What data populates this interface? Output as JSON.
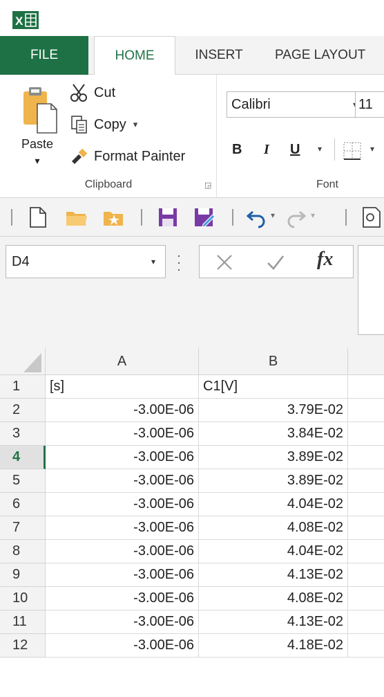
{
  "ribbon": {
    "tabs": {
      "file": "FILE",
      "home": "HOME",
      "insert": "INSERT",
      "page_layout": "PAGE LAYOUT"
    },
    "clipboard": {
      "paste": "Paste",
      "cut": "Cut",
      "copy": "Copy",
      "format_painter": "Format Painter",
      "group_label": "Clipboard"
    },
    "font": {
      "name": "Calibri",
      "size": "11",
      "bold": "B",
      "italic": "I",
      "underline": "U",
      "group_label": "Font"
    }
  },
  "icons": {
    "app": "excel-icon",
    "cut": "scissors-icon",
    "copy": "copy-icon",
    "format_painter": "paintbrush-icon",
    "qat": [
      "new-document-icon",
      "open-folder-icon",
      "favorite-folder-icon",
      "save-icon",
      "save-as-icon",
      "undo-icon",
      "redo-icon",
      "print-preview-icon"
    ]
  },
  "formula_bar": {
    "name_box": "D4",
    "fx": "fx",
    "formula": ""
  },
  "grid": {
    "columns": [
      "A",
      "B"
    ],
    "active_row": 4,
    "rows": [
      {
        "n": "1",
        "a": "[s]",
        "b": "C1[V]"
      },
      {
        "n": "2",
        "a": "-3.00E-06",
        "b": "3.79E-02"
      },
      {
        "n": "3",
        "a": "-3.00E-06",
        "b": "3.84E-02"
      },
      {
        "n": "4",
        "a": "-3.00E-06",
        "b": "3.89E-02"
      },
      {
        "n": "5",
        "a": "-3.00E-06",
        "b": "3.89E-02"
      },
      {
        "n": "6",
        "a": "-3.00E-06",
        "b": "4.04E-02"
      },
      {
        "n": "7",
        "a": "-3.00E-06",
        "b": "4.08E-02"
      },
      {
        "n": "8",
        "a": "-3.00E-06",
        "b": "4.04E-02"
      },
      {
        "n": "9",
        "a": "-3.00E-06",
        "b": "4.13E-02"
      },
      {
        "n": "10",
        "a": "-3.00E-06",
        "b": "4.08E-02"
      },
      {
        "n": "11",
        "a": "-3.00E-06",
        "b": "4.13E-02"
      },
      {
        "n": "12",
        "a": "-3.00E-06",
        "b": "4.18E-02"
      }
    ]
  },
  "colors": {
    "accent": "#217346",
    "file_tab": "#1e7145",
    "chrome": "#f3f3f3"
  }
}
